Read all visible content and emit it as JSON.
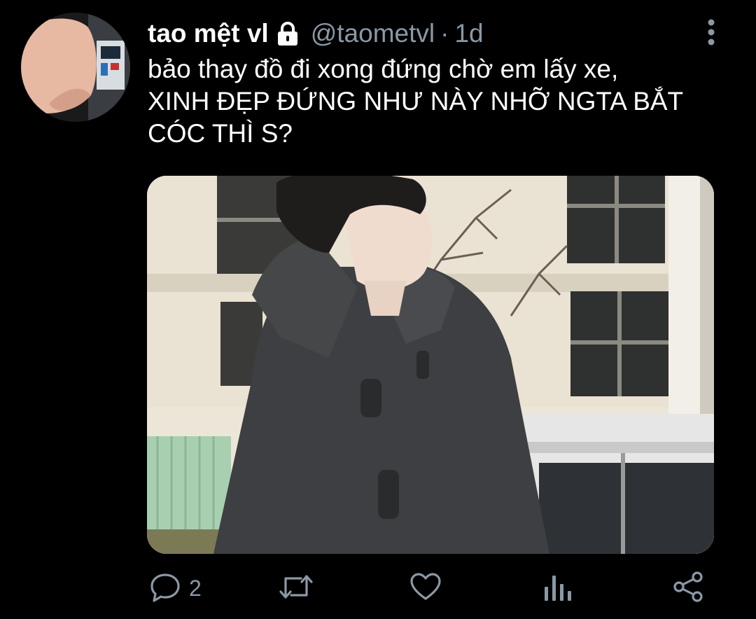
{
  "tweet": {
    "display_name": "tao mệt vl",
    "handle": "@taometvl",
    "separator": "·",
    "time": "1d",
    "text_lines": [
      "bảo thay đồ đi xong đứng chờ em lấy xe,",
      "XINH ĐẸP ĐỨNG NHƯ NÀY NHỠ NGTA BẮT",
      "CÓC THÌ S?"
    ]
  },
  "actions": {
    "reply_count": "2"
  },
  "icons": {
    "lock": "lock-icon",
    "more": "more-vertical-icon",
    "reply": "reply-icon",
    "retweet": "retweet-icon",
    "like": "heart-icon",
    "analytics": "analytics-icon",
    "share": "share-icon"
  },
  "colors": {
    "background": "#000000",
    "primary_text": "#ffffff",
    "secondary_text": "#8b98a5"
  }
}
